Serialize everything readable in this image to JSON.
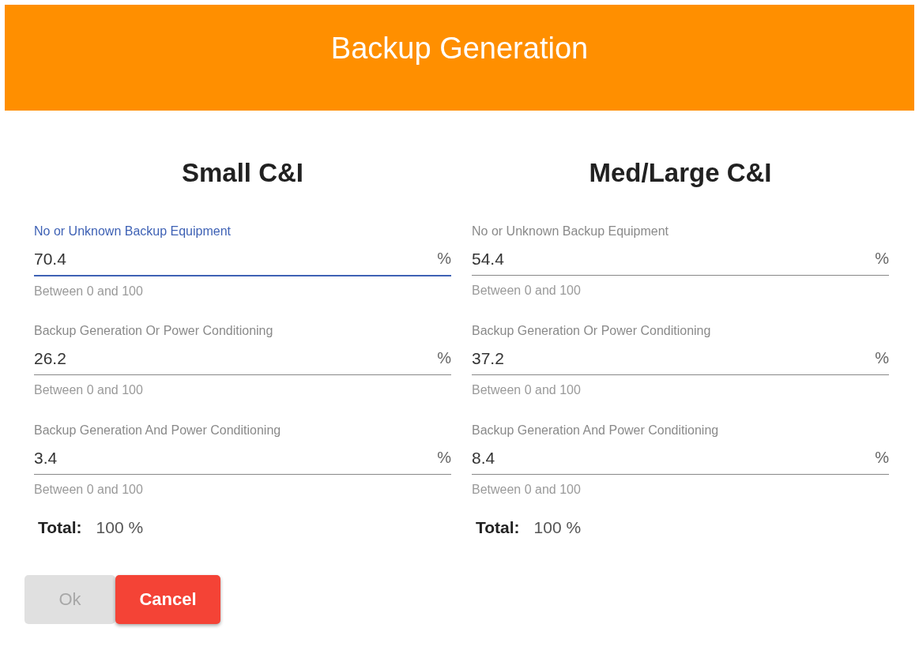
{
  "header": {
    "title": "Backup Generation"
  },
  "columns": [
    {
      "title": "Small C&I",
      "fields": [
        {
          "label": "No or Unknown Backup Equipment",
          "value": "70.4",
          "unit": "%",
          "hint": "Between 0 and 100",
          "focused": true
        },
        {
          "label": "Backup Generation Or Power Conditioning",
          "value": "26.2",
          "unit": "%",
          "hint": "Between 0 and 100",
          "focused": false
        },
        {
          "label": "Backup Generation And Power Conditioning",
          "value": "3.4",
          "unit": "%",
          "hint": "Between 0 and 100",
          "focused": false
        }
      ],
      "total_label": "Total:",
      "total_value": "100 %"
    },
    {
      "title": "Med/Large C&I",
      "fields": [
        {
          "label": "No or Unknown Backup Equipment",
          "value": "54.4",
          "unit": "%",
          "hint": "Between 0 and 100",
          "focused": false
        },
        {
          "label": "Backup Generation Or Power Conditioning",
          "value": "37.2",
          "unit": "%",
          "hint": "Between 0 and 100",
          "focused": false
        },
        {
          "label": "Backup Generation And Power Conditioning",
          "value": "8.4",
          "unit": "%",
          "hint": "Between 0 and 100",
          "focused": false
        }
      ],
      "total_label": "Total:",
      "total_value": "100 %"
    }
  ],
  "buttons": [
    {
      "label": "Ok",
      "kind": "ok",
      "disabled": true
    },
    {
      "label": "Cancel",
      "kind": "cancel",
      "disabled": false
    }
  ]
}
